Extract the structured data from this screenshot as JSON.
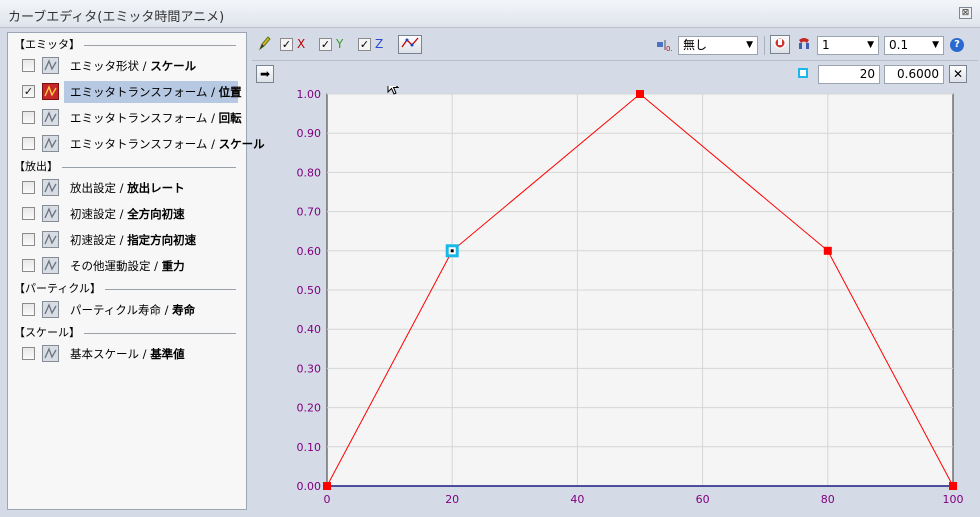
{
  "window": {
    "title": "カーブエディタ(エミッタ時間アニメ)",
    "close_glyph": "⊠"
  },
  "left_panel": {
    "sections": [
      {
        "title": "【エミッタ】",
        "items": [
          {
            "label": "エミッタ形状",
            "bold": "スケール",
            "checked": false,
            "active": false,
            "selected": false
          },
          {
            "label": "エミッタトランスフォーム",
            "bold": "位置",
            "checked": true,
            "active": true,
            "selected": true
          },
          {
            "label": "エミッタトランスフォーム",
            "bold": "回転",
            "checked": false,
            "active": false,
            "selected": false
          },
          {
            "label": "エミッタトランスフォーム",
            "bold": "スケール",
            "checked": false,
            "active": false,
            "selected": false
          }
        ]
      },
      {
        "title": "【放出】",
        "items": [
          {
            "label": "放出設定",
            "bold": "放出レート",
            "checked": false,
            "active": false,
            "selected": false
          },
          {
            "label": "初速設定",
            "bold": "全方向初速",
            "checked": false,
            "active": false,
            "selected": false
          },
          {
            "label": "初速設定",
            "bold": "指定方向初速",
            "checked": false,
            "active": false,
            "selected": false
          },
          {
            "label": "その他運動設定",
            "bold": "重力",
            "checked": false,
            "active": false,
            "selected": false
          }
        ]
      },
      {
        "title": "【パーティクル】",
        "items": [
          {
            "label": "パーティクル寿命",
            "bold": "寿命",
            "checked": false,
            "active": false,
            "selected": false
          }
        ]
      },
      {
        "title": "【スケール】",
        "items": [
          {
            "label": "基本スケール",
            "bold": "基準値",
            "checked": false,
            "active": false,
            "selected": false
          }
        ]
      }
    ]
  },
  "toolbar": {
    "axes": [
      {
        "label": "X",
        "checked": true,
        "color": "#c00000"
      },
      {
        "label": "Y",
        "checked": true,
        "color": "#3a9a2a"
      },
      {
        "label": "Z",
        "checked": true,
        "color": "#2a4ad0"
      }
    ],
    "snap_select": "無し",
    "step_select": "1",
    "value_select": "0.1",
    "help_glyph": "?"
  },
  "keyframe_editor": {
    "frame": "20",
    "value": "0.6000",
    "delete_glyph": "✕",
    "apply_glyph": "➡"
  },
  "chart_data": {
    "type": "line",
    "x": [
      0,
      20,
      50,
      80,
      100
    ],
    "series": [
      {
        "values": [
          0.0,
          0.6,
          1.0,
          0.6,
          0.0
        ],
        "color": "#ff0000"
      }
    ],
    "xlim": [
      0,
      100
    ],
    "ylim": [
      0.0,
      1.0
    ],
    "xticks": [
      "0",
      "20",
      "40",
      "60",
      "80",
      "100"
    ],
    "yticks": [
      "0.00",
      "0.10",
      "0.20",
      "0.30",
      "0.40",
      "0.50",
      "0.60",
      "0.70",
      "0.80",
      "0.90",
      "1.00"
    ],
    "selected_point_index": 1,
    "grid": true,
    "tick_color": "#800080"
  }
}
